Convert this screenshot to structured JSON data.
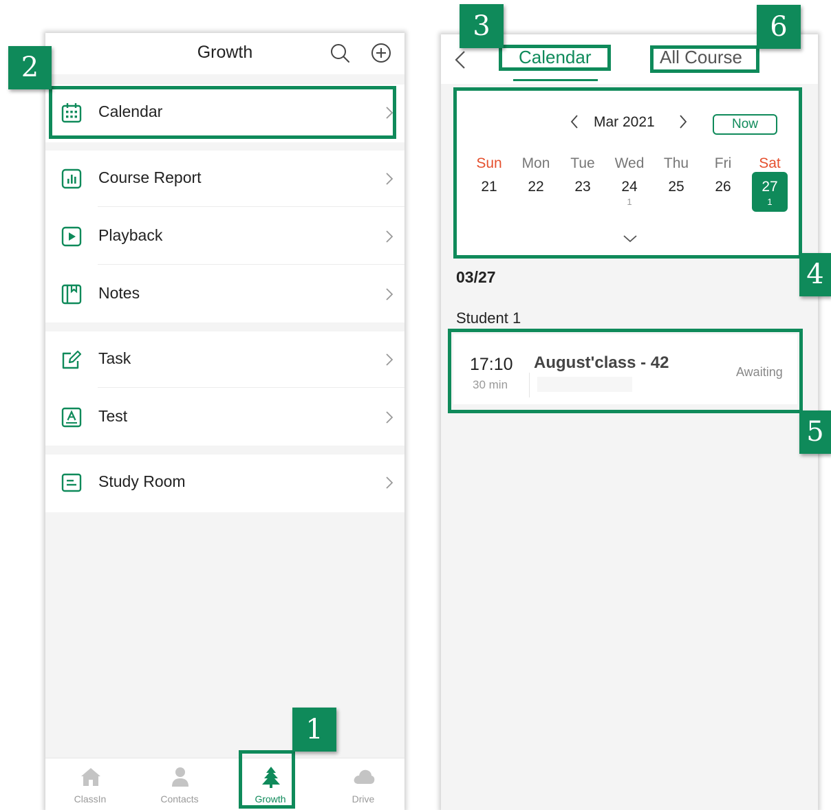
{
  "left": {
    "header": {
      "title": "Growth",
      "actions": [
        "search-icon",
        "add-circle-icon"
      ]
    },
    "menu": [
      {
        "label": "Calendar",
        "icon": "calendar-icon"
      },
      {
        "label": "Course Report",
        "icon": "bar-chart-icon"
      },
      {
        "label": "Playback",
        "icon": "play-icon"
      },
      {
        "label": "Notes",
        "icon": "notebook-icon"
      },
      {
        "label": "Task",
        "icon": "edit-icon"
      },
      {
        "label": "Test",
        "icon": "test-icon"
      },
      {
        "label": "Study Room",
        "icon": "study-room-icon"
      }
    ],
    "bottom_nav": [
      {
        "label": "ClassIn",
        "icon": "home-icon",
        "active": false
      },
      {
        "label": "Contacts",
        "icon": "person-icon",
        "active": false
      },
      {
        "label": "Growth",
        "icon": "tree-icon",
        "active": true
      },
      {
        "label": "Drive",
        "icon": "cloud-icon",
        "active": false
      }
    ]
  },
  "right": {
    "header": {
      "tabs": [
        {
          "label": "Calendar",
          "active": true
        },
        {
          "label": "All Course",
          "active": false
        }
      ]
    },
    "calendar": {
      "month": "Mar 2021",
      "now_label": "Now",
      "weekdays": [
        "Sun",
        "Mon",
        "Tue",
        "Wed",
        "Thu",
        "Fri",
        "Sat"
      ],
      "days": [
        {
          "num": "21",
          "count": ""
        },
        {
          "num": "22",
          "count": ""
        },
        {
          "num": "23",
          "count": ""
        },
        {
          "num": "24",
          "count": "1"
        },
        {
          "num": "25",
          "count": ""
        },
        {
          "num": "26",
          "count": ""
        },
        {
          "num": "27",
          "count": "1",
          "selected": true
        }
      ]
    },
    "date_heading": "03/27",
    "student_label": "Student  1",
    "class": {
      "time": "17:10",
      "duration": "30 min",
      "name": "August'class - 42",
      "status": "Awaiting"
    }
  },
  "annotations": [
    "1",
    "2",
    "3",
    "4",
    "5",
    "6"
  ],
  "colors": {
    "accent": "#0f8a5a",
    "weekend": "#e5502e",
    "background": "#f4f4f4"
  }
}
